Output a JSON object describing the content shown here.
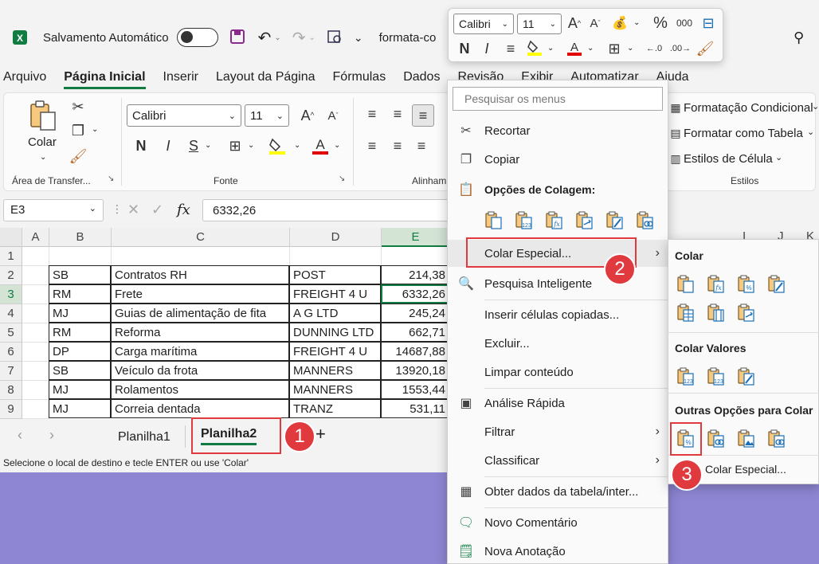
{
  "titlebar": {
    "autosave_label": "Salvamento Automático",
    "filename": "formata-co",
    "search_icon": "search-icon"
  },
  "menu_tabs": [
    "Arquivo",
    "Página Inicial",
    "Inserir",
    "Layout da Página",
    "Fórmulas",
    "Dados",
    "Revisão",
    "Exibir",
    "Automatizar",
    "Ajuda"
  ],
  "ribbon": {
    "paste_label": "Colar",
    "clipboard_label": "Área de Transfer...",
    "font_group_label": "Fonte",
    "align_group_label": "Alinham",
    "font_name": "Calibri",
    "font_size": "11",
    "styles": {
      "cond_format": "Formatação Condicional",
      "format_table": "Formatar como Tabela",
      "cell_styles": "Estilos de Célula",
      "group_label": "Estilos"
    }
  },
  "formula_bar": {
    "name_box": "E3",
    "fx": "fx",
    "value": "6332,26"
  },
  "grid": {
    "columns": [
      "A",
      "B",
      "C",
      "D",
      "E"
    ],
    "far_columns": [
      "I",
      "J",
      "K"
    ],
    "rows": [
      {
        "n": "1",
        "b": "",
        "c": "",
        "d": "",
        "e": ""
      },
      {
        "n": "2",
        "b": "SB",
        "c": "Contratos RH",
        "d": "POST",
        "e": "214,38"
      },
      {
        "n": "3",
        "b": "RM",
        "c": "Frete",
        "d": "FREIGHT 4 U",
        "e": "6332,26"
      },
      {
        "n": "4",
        "b": "MJ",
        "c": "Guias de alimentação de fita",
        "d": "A G LTD",
        "e": "245,24"
      },
      {
        "n": "5",
        "b": "RM",
        "c": "Reforma",
        "d": "DUNNING LTD",
        "e": "662,71"
      },
      {
        "n": "6",
        "b": "DP",
        "c": "Carga marítima",
        "d": "FREIGHT 4 U",
        "e": "14687,88"
      },
      {
        "n": "7",
        "b": "SB",
        "c": "Veículo da frota",
        "d": "MANNERS",
        "e": "13920,18"
      },
      {
        "n": "8",
        "b": "MJ",
        "c": "Rolamentos",
        "d": "MANNERS",
        "e": "1553,44"
      },
      {
        "n": "9",
        "b": "MJ",
        "c": "Correia dentada",
        "d": "TRANZ",
        "e": "531,11"
      }
    ]
  },
  "sheets": {
    "tab1": "Planilha1",
    "tab2": "Planilha2",
    "add": "+"
  },
  "status": "Selecione o local de destino e tecle ENTER ou use 'Colar'",
  "mini_toolbar": {
    "font": "Calibri",
    "size": "11",
    "percent": "%",
    "thousands": "000",
    "bold": "N",
    "italic": "I"
  },
  "context_menu": {
    "search_placeholder": "Pesquisar os menus",
    "cut": "Recortar",
    "copy": "Copiar",
    "paste_options": "Opções de Colagem:",
    "paste_special": "Colar Especial...",
    "smart_lookup": "Pesquisa Inteligente",
    "insert_copied": "Inserir células copiadas...",
    "delete": "Excluir...",
    "clear": "Limpar conteúdo",
    "quick_analysis": "Análise Rápida",
    "filter": "Filtrar",
    "sort": "Classificar",
    "get_data": "Obter dados da tabela/inter...",
    "new_comment": "Novo Comentário",
    "new_note": "Nova Anotação"
  },
  "submenu": {
    "paste_header": "Colar",
    "values_header": "Colar Valores",
    "other_header": "Outras Opções para Colar",
    "paste_special": "Colar Especial..."
  },
  "badges": [
    "1",
    "2",
    "3"
  ],
  "colors": {
    "excel_green": "#107c41",
    "highlight_red": "#e0393e",
    "background": "#8e86d2"
  }
}
